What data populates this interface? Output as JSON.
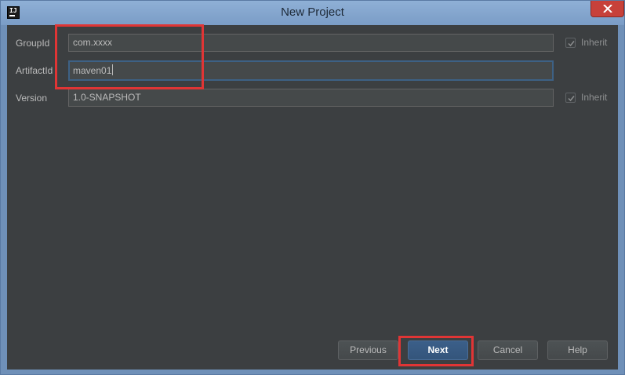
{
  "window": {
    "title": "New Project",
    "app_icon_text": "IJ"
  },
  "form": {
    "group_id": {
      "label": "GroupId",
      "value": "com.xxxx",
      "inherit_label": "Inherit",
      "inherit_checked": true
    },
    "artifact_id": {
      "label": "ArtifactId",
      "value": "maven01"
    },
    "version": {
      "label": "Version",
      "value": "1.0-SNAPSHOT",
      "inherit_label": "Inherit",
      "inherit_checked": true
    }
  },
  "buttons": {
    "previous": "Previous",
    "next": "Next",
    "cancel": "Cancel",
    "help": "Help"
  },
  "colors": {
    "background": "#3c3f41",
    "accent": "#3d6185",
    "highlight": "#e03535"
  }
}
